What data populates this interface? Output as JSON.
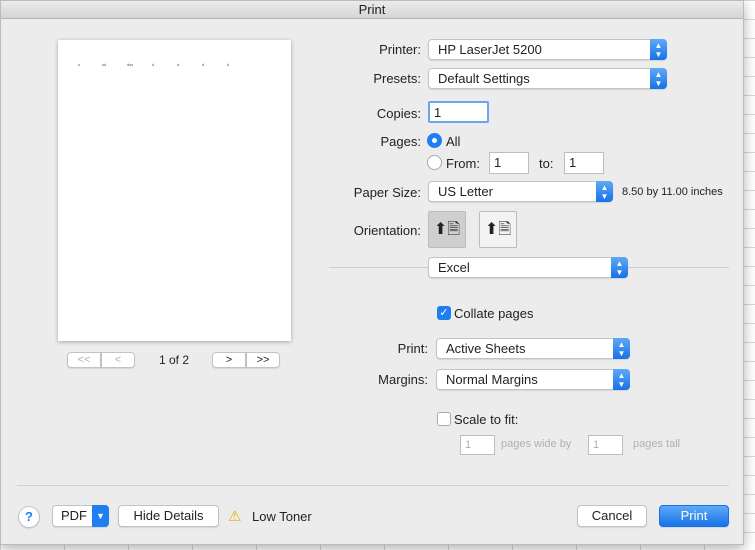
{
  "window": {
    "title": "Print"
  },
  "preview": {
    "cells": [
      "s",
      "sd",
      "dss",
      "d",
      "d",
      "d",
      "d"
    ],
    "page_indicator": "1 of 2",
    "first": "<<",
    "prev": "<",
    "next": ">",
    "last": ">>"
  },
  "printer": {
    "label": "Printer:",
    "value": "HP LaserJet 5200"
  },
  "presets": {
    "label": "Presets:",
    "value": "Default Settings"
  },
  "copies": {
    "label": "Copies:",
    "value": "1"
  },
  "pages": {
    "label": "Pages:",
    "all": "All",
    "from_label": "From:",
    "from": "1",
    "to_label": "to:",
    "to": "1",
    "selected": "All"
  },
  "paper": {
    "label": "Paper Size:",
    "value": "US Letter",
    "dims": "8.50 by 11.00 inches"
  },
  "orientation": {
    "label": "Orientation:",
    "selected": "portrait"
  },
  "section": {
    "value": "Excel"
  },
  "collate": {
    "label": "Collate pages",
    "checked": true
  },
  "print_what": {
    "label": "Print:",
    "value": "Active Sheets"
  },
  "margins": {
    "label": "Margins:",
    "value": "Normal Margins"
  },
  "scale": {
    "label": "Scale to fit:",
    "checked": false,
    "wide": "1",
    "wide_label": "pages wide by",
    "tall": "1",
    "tall_label": "pages tall"
  },
  "footer": {
    "help": "?",
    "pdf": "PDF",
    "hide_details": "Hide Details",
    "toner": "Low Toner",
    "cancel": "Cancel",
    "print": "Print"
  },
  "colors": {
    "accent": "#1d7ff0",
    "warning": "#e8b100"
  }
}
